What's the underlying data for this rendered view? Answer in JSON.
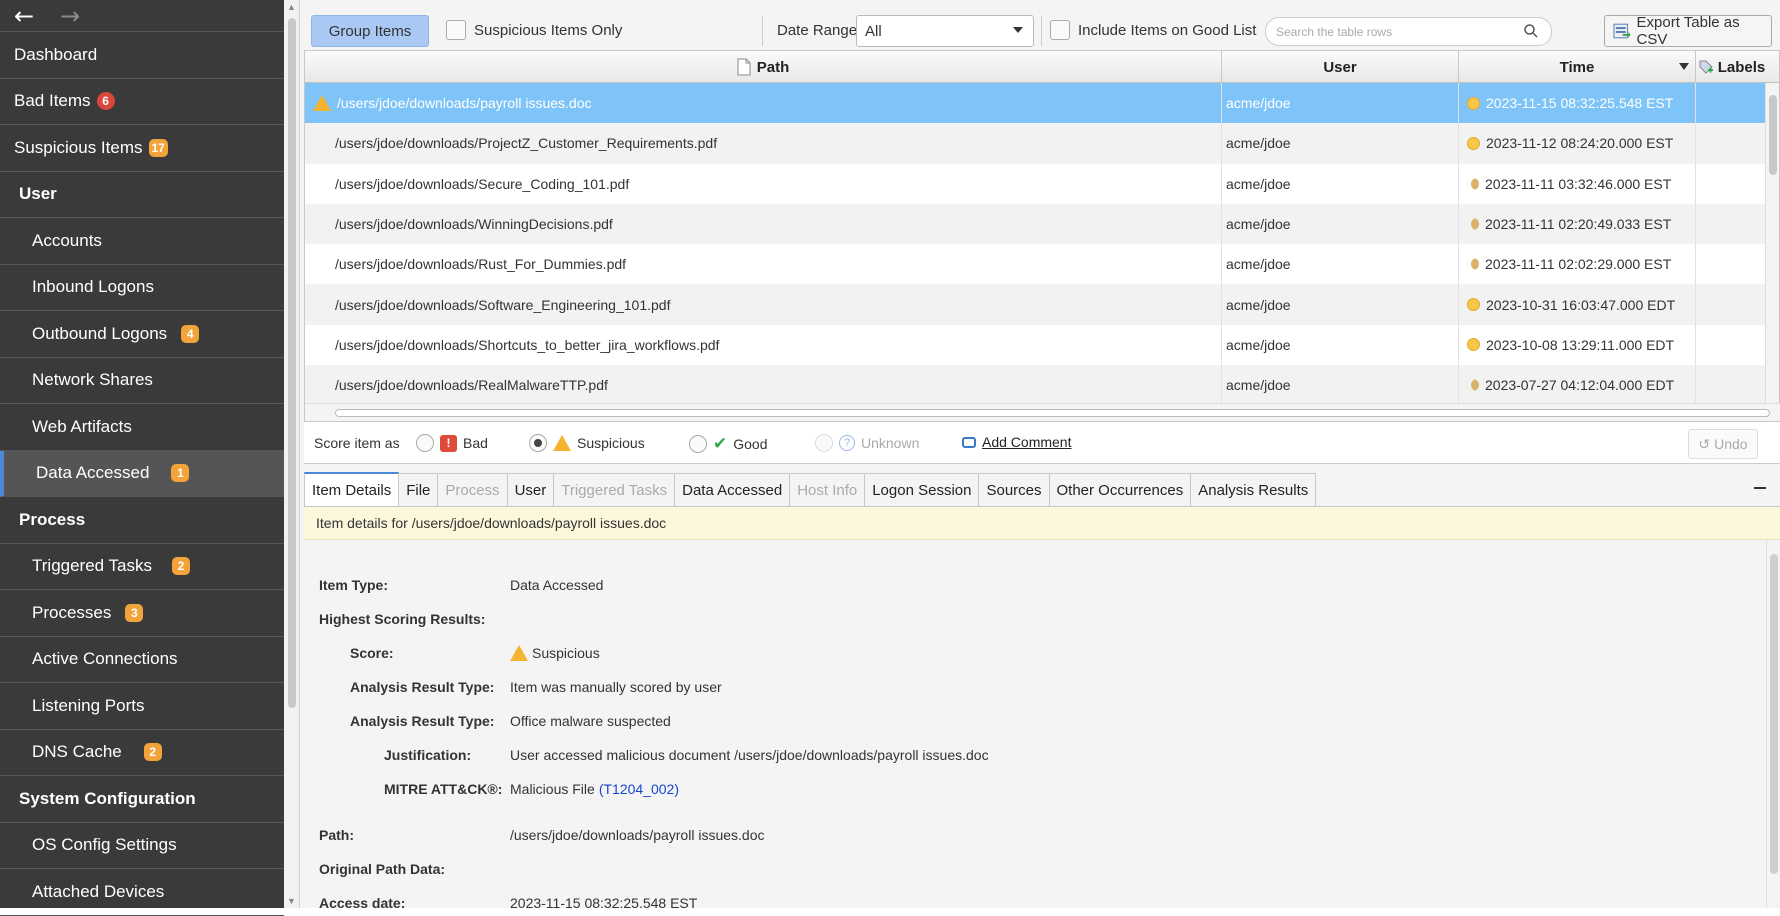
{
  "sidebar": {
    "back_icon": "arrow-left-icon",
    "forward_icon": "arrow-right-icon",
    "items": [
      {
        "label": "Dashboard"
      },
      {
        "label": "Bad Items",
        "badge": "6"
      },
      {
        "label": "Suspicious Items",
        "badge": "17"
      },
      {
        "label": "User"
      },
      {
        "label": "Accounts"
      },
      {
        "label": "Inbound Logons"
      },
      {
        "label": "Outbound Logons",
        "badge": "4"
      },
      {
        "label": "Network Shares"
      },
      {
        "label": "Web Artifacts"
      },
      {
        "label": "Data Accessed",
        "badge": "1"
      },
      {
        "label": "Process"
      },
      {
        "label": "Triggered Tasks",
        "badge": "2"
      },
      {
        "label": "Processes",
        "badge": "3"
      },
      {
        "label": "Active Connections"
      },
      {
        "label": "Listening Ports"
      },
      {
        "label": "DNS Cache",
        "badge": "2"
      },
      {
        "label": "System Configuration"
      },
      {
        "label": "OS Config Settings"
      },
      {
        "label": "Attached Devices"
      }
    ]
  },
  "toolbar": {
    "group_items": "Group Items",
    "suspicious_only": "Suspicious Items Only",
    "date_range_label": "Date Range",
    "date_range_value": "All",
    "include_good": "Include Items on Good List",
    "search_placeholder": "Search the table rows",
    "export": "Export Table as CSV"
  },
  "table": {
    "headers": {
      "path": "Path",
      "user": "User",
      "time": "Time",
      "labels": "Labels"
    },
    "rows": [
      {
        "path": "/users/jdoe/downloads/payroll issues.doc",
        "user": "acme/jdoe",
        "time": "2023-11-15 08:32:25.548 EST",
        "icon": "sun"
      },
      {
        "path": "/users/jdoe/downloads/ProjectZ_Customer_Requirements.pdf",
        "user": "acme/jdoe",
        "time": "2023-11-12 08:24:20.000 EST",
        "icon": "sun"
      },
      {
        "path": "/users/jdoe/downloads/Secure_Coding_101.pdf",
        "user": "acme/jdoe",
        "time": "2023-11-11 03:32:46.000 EST",
        "icon": "moon"
      },
      {
        "path": "/users/jdoe/downloads/WinningDecisions.pdf",
        "user": "acme/jdoe",
        "time": "2023-11-11 02:20:49.033 EST",
        "icon": "moon"
      },
      {
        "path": "/users/jdoe/downloads/Rust_For_Dummies.pdf",
        "user": "acme/jdoe",
        "time": "2023-11-11 02:02:29.000 EST",
        "icon": "moon"
      },
      {
        "path": "/users/jdoe/downloads/Software_Engineering_101.pdf",
        "user": "acme/jdoe",
        "time": "2023-10-31 16:03:47.000 EDT",
        "icon": "sun"
      },
      {
        "path": "/users/jdoe/downloads/Shortcuts_to_better_jira_workflows.pdf",
        "user": "acme/jdoe",
        "time": "2023-10-08 13:29:11.000 EDT",
        "icon": "sun"
      },
      {
        "path": "/users/jdoe/downloads/RealMalwareTTP.pdf",
        "user": "acme/jdoe",
        "time": "2023-07-27 04:12:04.000 EDT",
        "icon": "moon"
      }
    ]
  },
  "scorebar": {
    "label": "Score item as",
    "bad": "Bad",
    "suspicious": "Suspicious",
    "good": "Good",
    "unknown": "Unknown",
    "add_comment": "Add Comment",
    "undo": "Undo",
    "selected": "Suspicious"
  },
  "tabs": [
    {
      "label": "Item Details",
      "state": "active"
    },
    {
      "label": "File",
      "state": "enabled"
    },
    {
      "label": "Process",
      "state": "disabled"
    },
    {
      "label": "User",
      "state": "enabled"
    },
    {
      "label": "Triggered Tasks",
      "state": "disabled"
    },
    {
      "label": "Data Accessed",
      "state": "enabled"
    },
    {
      "label": "Host Info",
      "state": "disabled"
    },
    {
      "label": "Logon Session",
      "state": "enabled"
    },
    {
      "label": "Sources",
      "state": "enabled"
    },
    {
      "label": "Other Occurrences",
      "state": "enabled"
    },
    {
      "label": "Analysis Results",
      "state": "enabled"
    }
  ],
  "details": {
    "banner": "Item details for /users/jdoe/downloads/payroll issues.doc",
    "item_type_label": "Item Type:",
    "item_type": "Data Accessed",
    "highest_label": "Highest Scoring Results:",
    "score_label": "Score:",
    "score": "Suspicious",
    "art1_label": "Analysis Result Type:",
    "art1": "Item was manually scored by user",
    "art2_label": "Analysis Result Type:",
    "art2": "Office malware suspected",
    "justification_label": "Justification:",
    "justification": "User accessed malicious document /users/jdoe/downloads/payroll issues.doc",
    "mitre_label": "MITRE ATT&CK®:",
    "mitre_value": "Malicious File",
    "mitre_link": "(T1204_002)",
    "path_label": "Path:",
    "path": "/users/jdoe/downloads/payroll issues.doc",
    "orig_path_label": "Original Path Data:",
    "access_date_label": "Access date:",
    "access_date": "2023-11-15 08:32:25.548 EST"
  },
  "colors": {
    "sidebar_bg": "#3a3a3a",
    "selected_row": "#7ec4f8",
    "badge_red": "#d9463a",
    "badge_orange": "#f2a33a",
    "accent": "#4a88d8"
  }
}
